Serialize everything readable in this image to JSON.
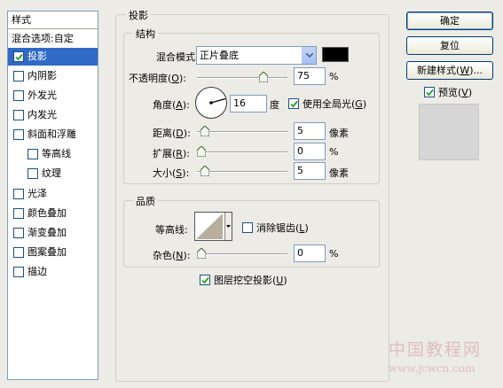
{
  "style_list": {
    "header": "样式",
    "blend_options": "混合选项:自定",
    "items": [
      {
        "label": "投影",
        "checked": true,
        "selected": true,
        "sub": false
      },
      {
        "label": "内阴影",
        "checked": false,
        "sub": false
      },
      {
        "label": "外发光",
        "checked": false,
        "sub": false
      },
      {
        "label": "内发光",
        "checked": false,
        "sub": false
      },
      {
        "label": "斜面和浮雕",
        "checked": false,
        "sub": false
      },
      {
        "label": "等高线",
        "checked": false,
        "sub": true
      },
      {
        "label": "纹理",
        "checked": false,
        "sub": true
      },
      {
        "label": "光泽",
        "checked": false,
        "sub": false
      },
      {
        "label": "颜色叠加",
        "checked": false,
        "sub": false
      },
      {
        "label": "渐变叠加",
        "checked": false,
        "sub": false
      },
      {
        "label": "图案叠加",
        "checked": false,
        "sub": false
      },
      {
        "label": "描边",
        "checked": false,
        "sub": false
      }
    ]
  },
  "drop_shadow": {
    "title": "投影",
    "structure": {
      "title": "结构",
      "blend_mode_label": "混合模式:",
      "blend_mode_value": "正片叠底",
      "shadow_color": "#000000",
      "opacity_label": "不透明度(",
      "opacity_key": "O",
      "opacity_value": "75",
      "opacity_unit": "%",
      "angle_label": "角度(",
      "angle_key": "A",
      "angle_value": "16",
      "angle_unit": "度",
      "global_light_label": "使用全局光(",
      "global_light_key": "G",
      "global_light_checked": true,
      "distance_label": "距离(",
      "distance_key": "D",
      "distance_value": "5",
      "distance_unit": "像素",
      "spread_label": "扩展(",
      "spread_key": "R",
      "spread_value": "0",
      "spread_unit": "%",
      "size_label": "大小(",
      "size_key": "S",
      "size_value": "5",
      "size_unit": "像素"
    },
    "quality": {
      "title": "品质",
      "contour_label": "等高线:",
      "anti_alias_label": "消除锯齿(",
      "anti_alias_key": "L",
      "anti_alias_checked": false,
      "noise_label": "杂色(",
      "noise_key": "N",
      "noise_value": "0",
      "noise_unit": "%"
    },
    "knockout_label": "图层挖空投影(",
    "knockout_key": "U",
    "knockout_checked": true
  },
  "buttons": {
    "ok": "确定",
    "reset": "复位",
    "new_style": "新建样式(",
    "new_style_key": "W",
    "new_style_suffix": ")...",
    "preview_label": "预览(",
    "preview_key": "V",
    "preview_checked": true
  },
  "close_paren": ")",
  "colon_suffix": "):",
  "watermark": {
    "line1": "中国教程网",
    "line2": "www.jcwcn.com"
  },
  "colors": {
    "selection": "#316ac5",
    "dialog_bg": "#ecebe6",
    "checkmark": "#21a121"
  }
}
